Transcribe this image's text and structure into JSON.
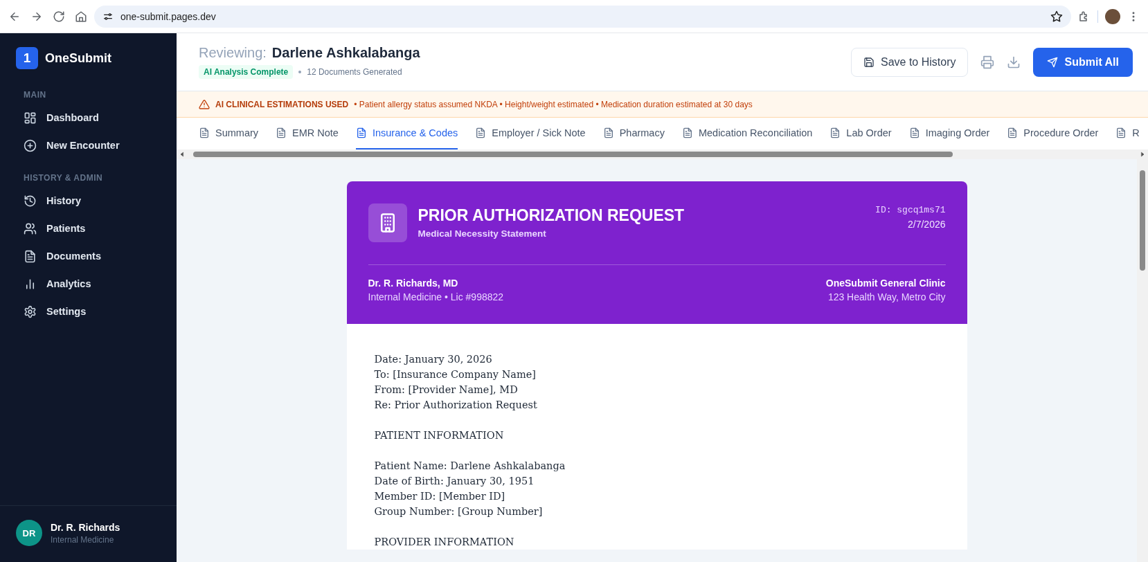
{
  "browser": {
    "url": "one-submit.pages.dev"
  },
  "sidebar": {
    "logo_mark": "1",
    "brand": "OneSubmit",
    "sections": [
      {
        "heading": "MAIN",
        "items": [
          {
            "label": "Dashboard",
            "selected": false
          },
          {
            "label": "New Encounter",
            "selected": false
          }
        ]
      },
      {
        "heading": "HISTORY & ADMIN",
        "items": [
          {
            "label": "History",
            "selected": false
          },
          {
            "label": "Patients",
            "selected": false
          },
          {
            "label": "Documents",
            "selected": false
          },
          {
            "label": "Analytics",
            "selected": false
          },
          {
            "label": "Settings",
            "selected": false
          }
        ]
      }
    ],
    "user": {
      "initials": "DR",
      "name": "Dr. R. Richards",
      "role": "Internal Medicine"
    }
  },
  "header": {
    "prefix": "Reviewing:",
    "patient": "Darlene Ashkalabanga",
    "status": "AI Analysis Complete",
    "doc_count": "12 Documents Generated",
    "save_button": "Save to History",
    "submit_button": "Submit All"
  },
  "banner": {
    "title": "AI CLINICAL ESTIMATIONS USED",
    "details": "• Patient allergy status assumed NKDA • Height/weight estimated • Medication duration estimated at 30 days"
  },
  "tabs": [
    {
      "label": "Summary",
      "selected": false
    },
    {
      "label": "EMR Note",
      "selected": false
    },
    {
      "label": "Insurance & Codes",
      "selected": true
    },
    {
      "label": "Employer / Sick Note",
      "selected": false
    },
    {
      "label": "Pharmacy",
      "selected": false
    },
    {
      "label": "Medication Reconciliation",
      "selected": false
    },
    {
      "label": "Lab Order",
      "selected": false
    },
    {
      "label": "Imaging Order",
      "selected": false
    },
    {
      "label": "Procedure Order",
      "selected": false
    },
    {
      "label": "R",
      "selected": false
    }
  ],
  "document": {
    "title": "PRIOR AUTHORIZATION REQUEST",
    "subtitle": "Medical Necessity Statement",
    "id": "ID: sgcq1ms71",
    "date": "2/7/2026",
    "provider_name": "Dr. R. Richards, MD",
    "provider_detail": "Internal Medicine • Lic #998822",
    "clinic_name": "OneSubmit General Clinic",
    "clinic_address": "123 Health Way, Metro City",
    "paragraphs": [
      [
        "Date: January 30, 2026",
        "To: [Insurance Company Name]",
        "From: [Provider Name], MD",
        "Re: Prior Authorization Request"
      ],
      [
        "PATIENT INFORMATION"
      ],
      [
        "Patient Name: Darlene Ashkalabanga",
        "Date of Birth: January 30, 1951",
        "Member ID: [Member ID]",
        "Group Number: [Group Number]"
      ],
      [
        "PROVIDER INFORMATION"
      ]
    ]
  }
}
